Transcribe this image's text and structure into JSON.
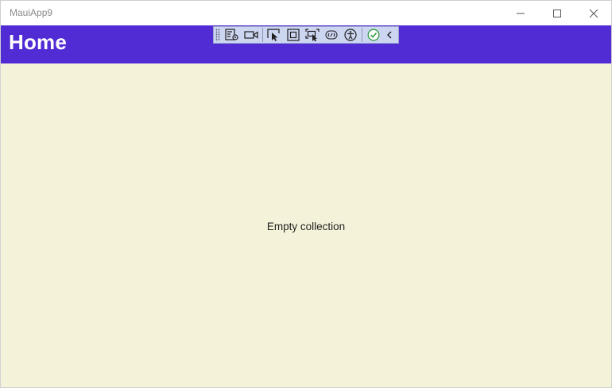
{
  "window": {
    "title": "MauiApp9"
  },
  "caption_buttons": [
    {
      "name": "minimize",
      "icon": "minimize-icon"
    },
    {
      "name": "maximize",
      "icon": "maximize-icon"
    },
    {
      "name": "close",
      "icon": "close-icon"
    }
  ],
  "header": {
    "title": "Home",
    "background": "#512bd4"
  },
  "debug_toolbar": {
    "background": "#cdd6f1",
    "buttons": [
      {
        "icon": "live-visual-tree-icon"
      },
      {
        "icon": "video-camera-icon"
      },
      {
        "icon": "select-element-icon"
      },
      {
        "icon": "display-layout-adorners-icon"
      },
      {
        "icon": "track-focus-icon"
      },
      {
        "icon": "binding-failures-icon"
      },
      {
        "icon": "accessibility-checker-icon"
      },
      {
        "icon": "checkmark-status-icon",
        "color": "#2e9e3c"
      },
      {
        "icon": "chevron-left-icon"
      }
    ]
  },
  "content": {
    "background": "#f4f3da",
    "empty_message": "Empty collection"
  }
}
